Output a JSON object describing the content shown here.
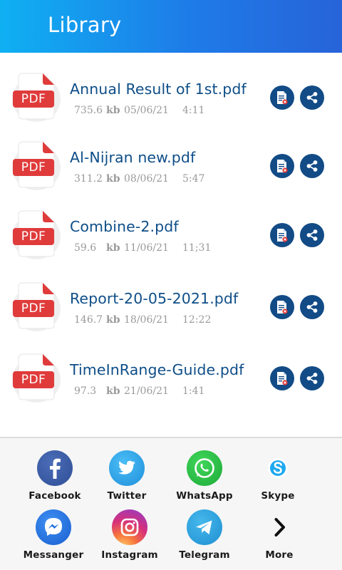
{
  "header": {
    "title": "Library"
  },
  "files": [
    {
      "name": "Annual Result of 1st.pdf",
      "size": "735.6",
      "unit": "kb",
      "date": "05/06/21",
      "time": "4:11",
      "badge": "PDF"
    },
    {
      "name": "Al-Nijran new.pdf",
      "size": "311.2",
      "unit": "kb",
      "date": "08/06/21",
      "time": "5:47",
      "badge": "PDF"
    },
    {
      "name": "Combine-2.pdf",
      "size": "59.6",
      "unit": "kb",
      "date": "11/06/21",
      "time": "11;31",
      "badge": "PDF"
    },
    {
      "name": "Report-20-05-2021.pdf",
      "size": "146.7",
      "unit": "kb",
      "date": "18/06/21",
      "time": "12:22",
      "badge": "PDF"
    },
    {
      "name": "TimeInRange-Guide.pdf",
      "size": "97.3",
      "unit": "kb",
      "date": "21/06/21",
      "time": "1:41",
      "badge": "PDF"
    }
  ],
  "share_apps": [
    {
      "label": "Facebook",
      "icon": "facebook-icon",
      "color": "#3b5998"
    },
    {
      "label": "Twitter",
      "icon": "twitter-icon",
      "color": "#2aa3ef"
    },
    {
      "label": "WhatsApp",
      "icon": "whatsapp-icon",
      "color": "#25c33f"
    },
    {
      "label": "Skype",
      "icon": "skype-icon",
      "color": "#1fa9f0"
    },
    {
      "label": "Messanger",
      "icon": "messenger-icon",
      "color": "#1f6fe0"
    },
    {
      "label": "Instagram",
      "icon": "instagram-icon",
      "color": "#d6307a"
    },
    {
      "label": "Telegram",
      "icon": "telegram-icon",
      "color": "#2aa4e0"
    },
    {
      "label": "More",
      "icon": "chevron-right-icon",
      "color": "#111111"
    }
  ],
  "colors": {
    "header_start": "#0fb0f2",
    "header_end": "#2763d9",
    "file_name": "#0e4e88",
    "action_button": "#124b86",
    "pdf_red": "#e03b3b"
  }
}
